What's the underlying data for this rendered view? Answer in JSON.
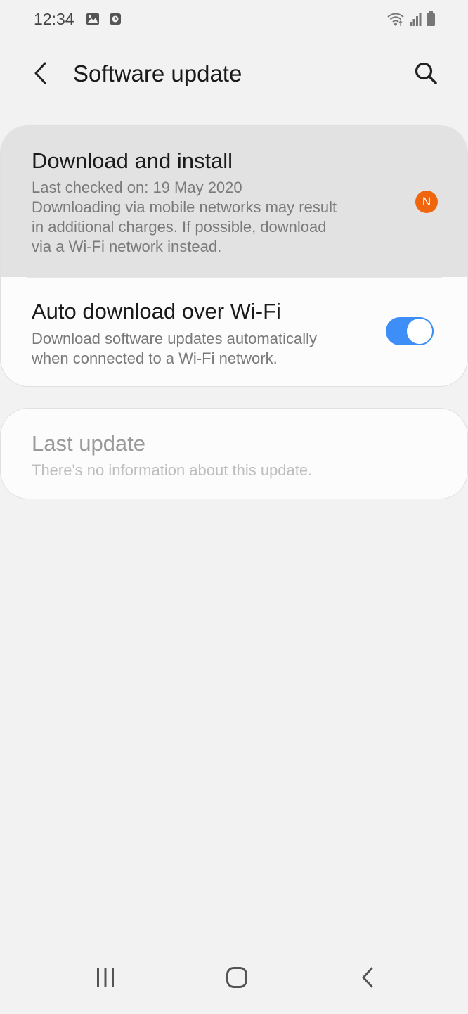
{
  "status_bar": {
    "time": "12:34",
    "left_icons": [
      "gallery-icon",
      "screen-recorder-icon"
    ],
    "right_icons": [
      "wifi-icon",
      "signal-icon",
      "battery-icon"
    ]
  },
  "header": {
    "title": "Software update",
    "back_icon": "back-arrow-icon",
    "search_icon": "search-icon"
  },
  "settings": {
    "download": {
      "title": "Download and install",
      "last_checked": "Last checked on: 19 May 2020",
      "note_line1": "Downloading via mobile networks may result",
      "note_line2": "in additional charges. If possible, download",
      "note_line3": "via a Wi-Fi network instead.",
      "badge": "N",
      "badge_color": "#f0660f"
    },
    "auto_download": {
      "title": "Auto download over Wi-Fi",
      "desc_line1": "Download software updates automatically",
      "desc_line2": "when connected to a Wi-Fi network.",
      "enabled": true,
      "accent_color": "#3e8ef7"
    },
    "last_update": {
      "title": "Last update",
      "desc": "There's no information about this update."
    }
  },
  "nav_bar": {
    "icons": [
      "recent-apps-icon",
      "home-icon",
      "back-nav-icon"
    ]
  }
}
